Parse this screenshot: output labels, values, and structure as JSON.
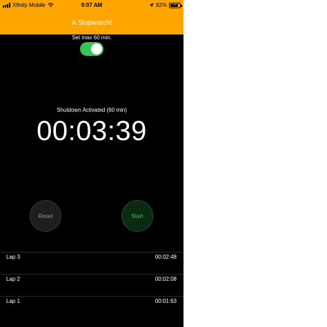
{
  "status_bar": {
    "carrier": "Xfinity Mobile",
    "time": "9:07 AM",
    "battery_text": "82%",
    "battery_level": 0.82
  },
  "header": {
    "title": "A Stopwatch!"
  },
  "max_toggle": {
    "label": "Set max 60 min.",
    "on": true
  },
  "shutdown_text": "Shutdown Activated (60 min)",
  "timer_display": "00:03:39",
  "buttons": {
    "reset": "Reset",
    "start": "Start"
  },
  "laps": [
    {
      "name": "Lap 3",
      "time": "00:02:48"
    },
    {
      "name": "Lap 2",
      "time": "00:02:08"
    },
    {
      "name": "Lap 1",
      "time": "00:01:63"
    }
  ],
  "colors": {
    "accent": "#ffa500",
    "toggle_on": "#35c759",
    "background": "#000000"
  }
}
